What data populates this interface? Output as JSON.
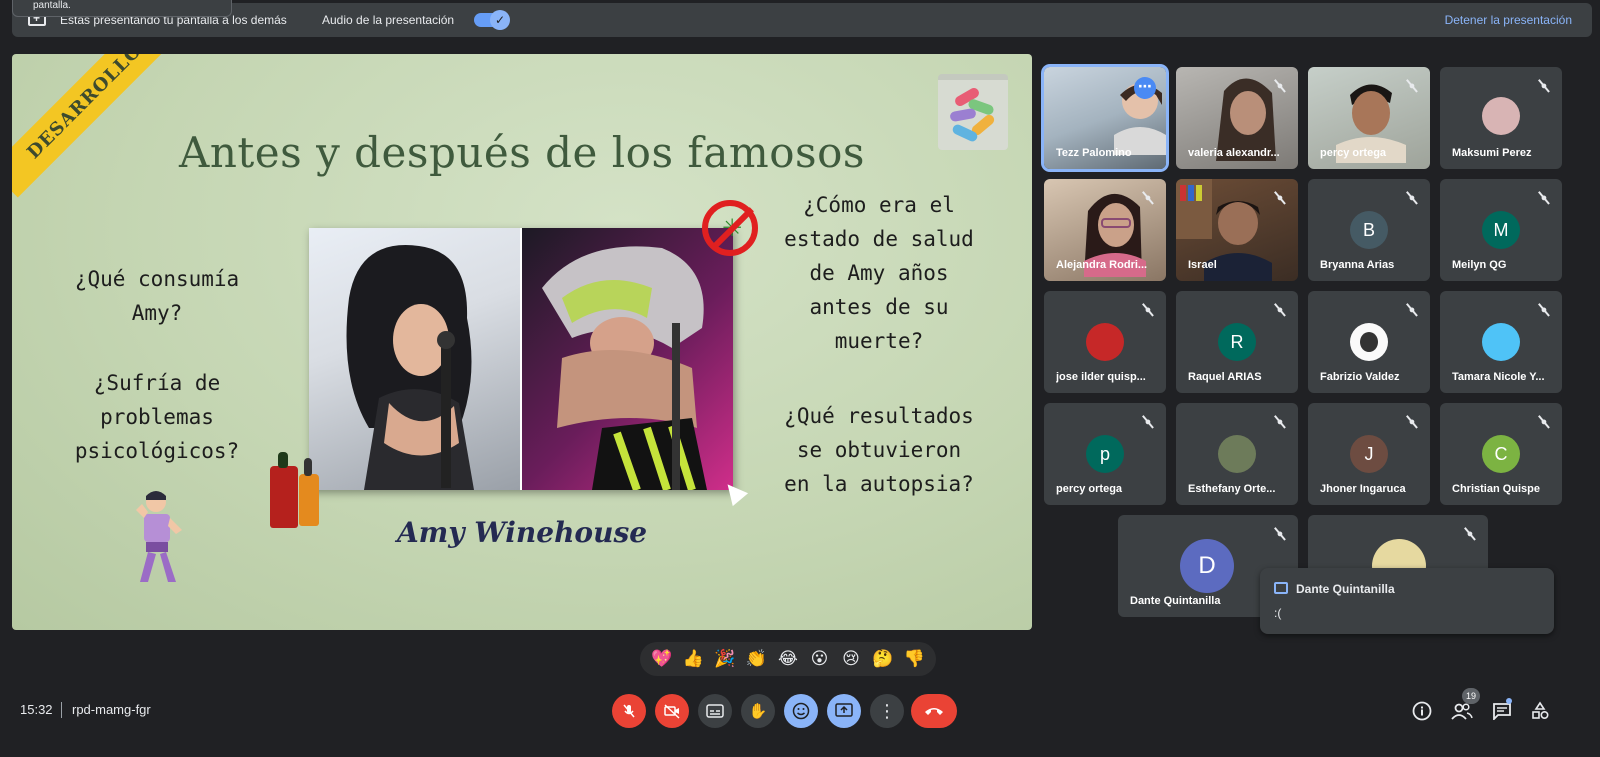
{
  "topbar": {
    "tooltip_text": "pantalla.",
    "presenting_text": "Estás presentando tu pantalla a los demás",
    "audio_label": "Audio de la presentación",
    "stop_label": "Detener la presentación"
  },
  "slide": {
    "ribbon": "DESARROLLO",
    "title": "Antes y después de los famosos",
    "left_q1": "¿Qué consumía Amy?",
    "left_q2": "¿Sufría de problemas psicológicos?",
    "right_q1": "¿Cómo era el estado de salud de Amy años antes de su muerte?",
    "right_q2": "¿Qué resultados se obtuvieron en la autopsia?",
    "caption": "Amy Winehouse"
  },
  "participants": [
    {
      "name": "Tezz Palomino",
      "avatar": "",
      "color": ""
    },
    {
      "name": "valeria alexandr...",
      "avatar": "",
      "color": ""
    },
    {
      "name": "percy ortega",
      "avatar": "",
      "color": ""
    },
    {
      "name": "Maksumi Perez",
      "avatar": "",
      "color": "#e8c0c0"
    },
    {
      "name": "Alejandra Rodri...",
      "avatar": "",
      "color": ""
    },
    {
      "name": "Israel",
      "avatar": "",
      "color": ""
    },
    {
      "name": "Bryanna Arias",
      "avatar": "B",
      "color": "#455a64"
    },
    {
      "name": "Meilyn QG",
      "avatar": "M",
      "color": "#00695c"
    },
    {
      "name": "jose ilder quisp...",
      "avatar": "",
      "color": "#c62828"
    },
    {
      "name": "Raquel ARIAS",
      "avatar": "R",
      "color": "#00695c"
    },
    {
      "name": "Fabrizio Valdez",
      "avatar": "",
      "color": "#fafafa"
    },
    {
      "name": "Tamara Nicole Y...",
      "avatar": "",
      "color": "#4fc3f7"
    },
    {
      "name": "percy ortega",
      "avatar": "p",
      "color": "#00695c"
    },
    {
      "name": "Esthefany Orte...",
      "avatar": "",
      "color": "#6d7b5a"
    },
    {
      "name": "Jhoner Ingaruca",
      "avatar": "J",
      "color": "#6d4c41"
    },
    {
      "name": "Christian Quispe",
      "avatar": "C",
      "color": "#7cb342"
    },
    {
      "name": "Dante Quintanilla",
      "avatar": "D",
      "color": "#5c6bc0"
    },
    {
      "name": "",
      "avatar": "",
      "color": "#e6d9a0"
    }
  ],
  "chat_toast": {
    "sender": "Dante Quintanilla",
    "message": ":("
  },
  "reactions": [
    "💖",
    "👍",
    "🎉",
    "👏",
    "😂",
    "😮",
    "😢",
    "🤔",
    "👎"
  ],
  "bottom": {
    "time": "15:32",
    "meeting_code": "rpd-mamg-fgr",
    "people_count": "19"
  },
  "icons": {
    "mic": "mic-off-icon",
    "camera": "camera-off-icon",
    "captions": "captions-icon",
    "hand": "raise-hand-icon",
    "emoji": "emoji-icon",
    "present": "present-screen-icon",
    "more": "more-options-icon",
    "end": "end-call-icon",
    "info": "info-icon",
    "people": "people-icon",
    "chat": "chat-icon",
    "activities": "activities-icon"
  },
  "colors": {
    "accent": "#8ab4f8",
    "danger": "#ea4335",
    "background": "#202124",
    "tile": "#3c4043"
  }
}
